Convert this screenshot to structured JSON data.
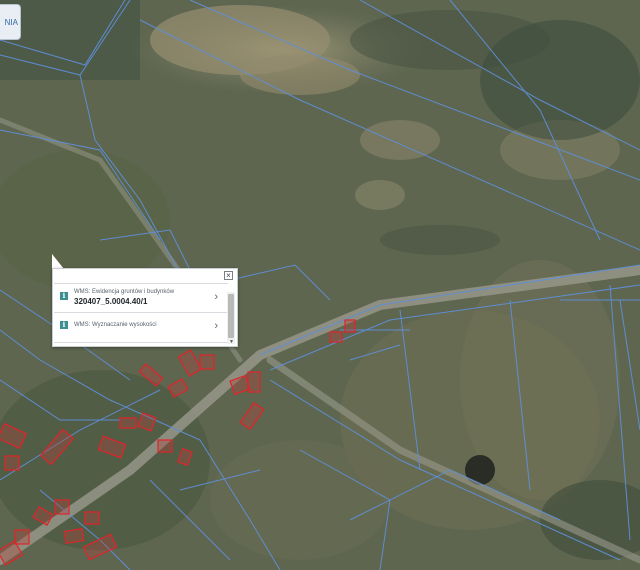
{
  "map": {
    "corner_tab_label": "NIA",
    "colors": {
      "parcel_lines": "#5f8fd8",
      "building_outline": "#e0242a",
      "terrain_dark": "#4f5a45",
      "terrain_light": "#8d8b6f"
    }
  },
  "popup": {
    "close_label": "×",
    "items": [
      {
        "title": "WMS: Ewidencja gruntów i budynków",
        "id": "320407_5.0004.40/1",
        "icon": "info-icon",
        "arrow": "›"
      },
      {
        "title": "WMS: Wyznaczanie wysokości",
        "id": "",
        "icon": "info-icon",
        "arrow": "›"
      }
    ],
    "scroll_down_label": "▼"
  }
}
